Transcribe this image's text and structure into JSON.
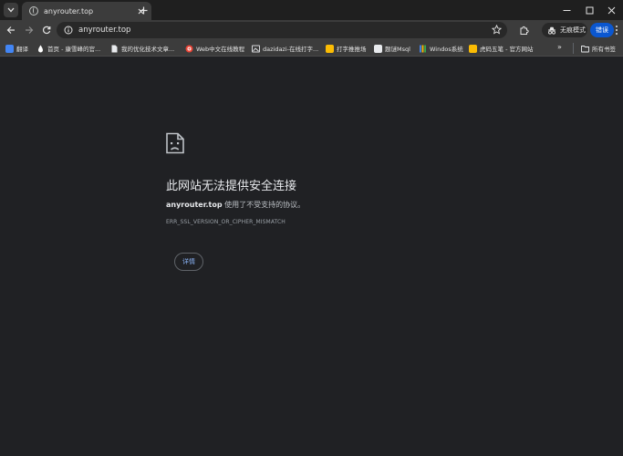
{
  "tab": {
    "title": "anyrouter.top"
  },
  "toolbar": {
    "url": "anyrouter.top",
    "incognito_label": "无痕模式",
    "error_label": "错误"
  },
  "bookmarks": {
    "items": [
      {
        "label": "翻译",
        "icon": "translate-icon",
        "color": "#4285f4"
      },
      {
        "label": "首页 - 康雪峰的官...",
        "icon": "water-drop-icon",
        "color": "#ffffff"
      },
      {
        "label": "我的优化技术文章...",
        "icon": "document-icon",
        "color": "#e8eaed"
      },
      {
        "label": "Web中文在线教程",
        "icon": "target-icon",
        "color": "#ea4335"
      },
      {
        "label": "dazidazi-在线打字...",
        "icon": "image-icon",
        "color": "#e8eaed"
      },
      {
        "label": "打字推推场",
        "icon": "keyboard-icon",
        "color": "#fbbc04"
      },
      {
        "label": "题谜Msql",
        "icon": "puzzle-icon",
        "color": "#e8eaed"
      },
      {
        "label": "Windos系统",
        "icon": "bars-icon",
        "color": "#fbbc04"
      },
      {
        "label": "虎码五笔 - 官方网站",
        "icon": "tiger-icon",
        "color": "#fbbc04"
      }
    ],
    "all_bookmarks_label": "所有书签"
  },
  "error": {
    "title": "此网站无法提供安全连接",
    "host": "anyrouter.top",
    "description": " 使用了不受支持的协议。",
    "code": "ERR_SSL_VERSION_OR_CIPHER_MISMATCH",
    "details_label": "详情"
  },
  "colors": {
    "page_background": "#202124",
    "toolbar": "#3c3c3c",
    "accent": "#0b57d0",
    "link": "#8ab4f8"
  }
}
